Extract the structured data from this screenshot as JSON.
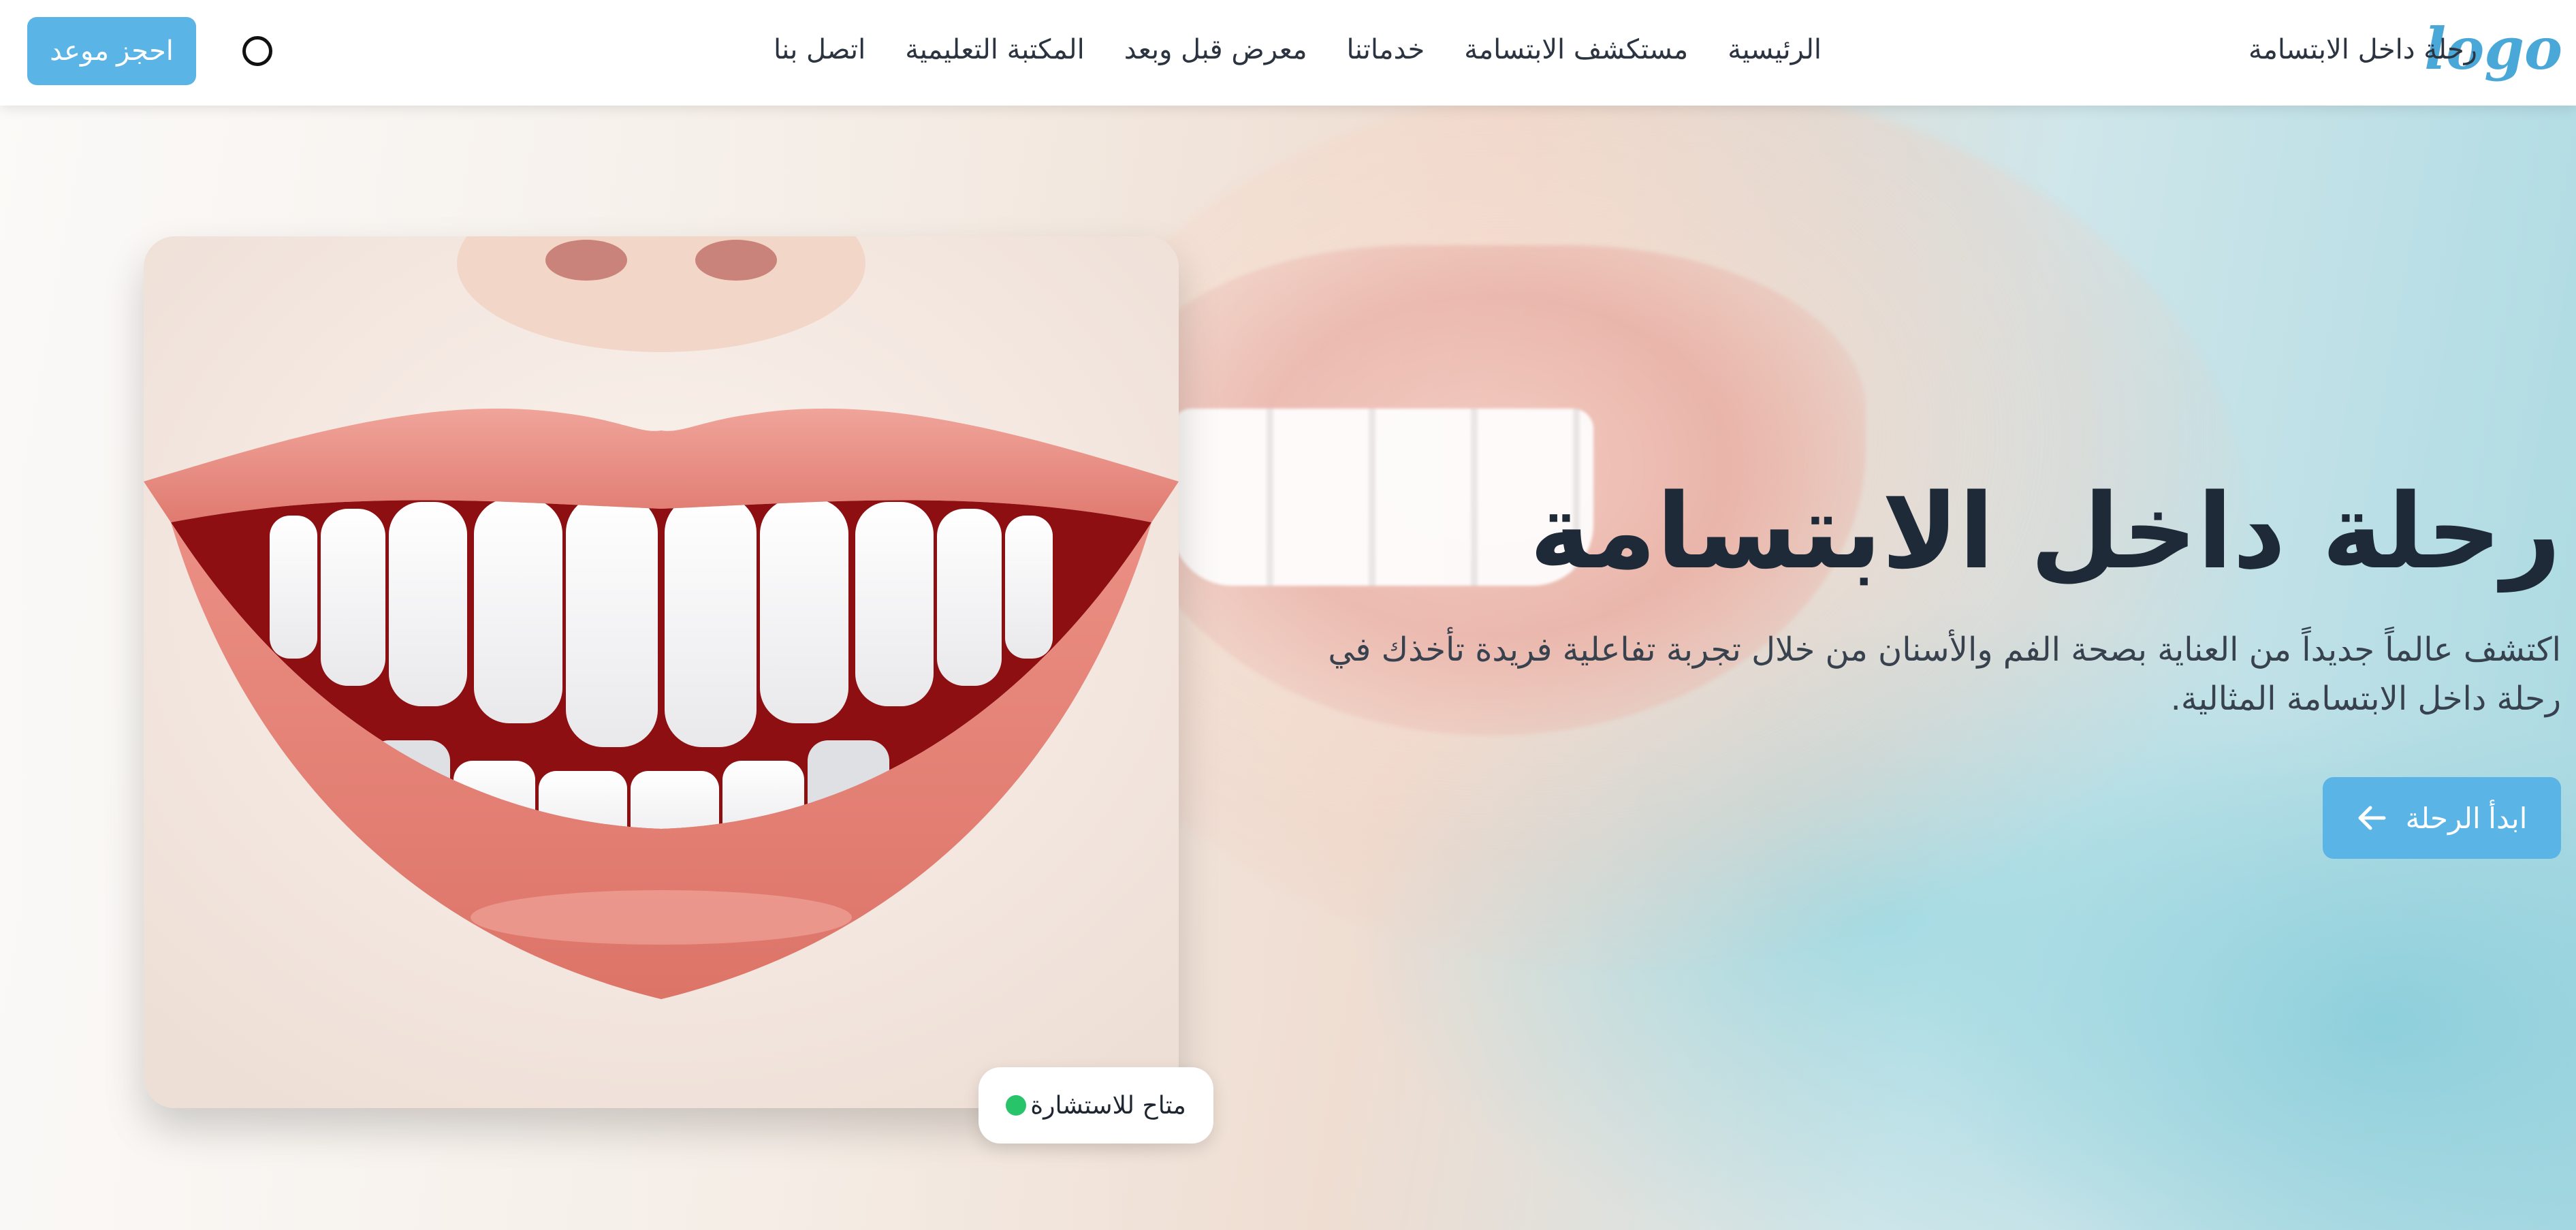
{
  "header": {
    "logo": "logo",
    "brand_name": "رحلة داخل الابتسامة",
    "nav": [
      {
        "label": "الرئيسية"
      },
      {
        "label": "مستكشف الابتسامة"
      },
      {
        "label": "خدماتنا"
      },
      {
        "label": "معرض قبل وبعد"
      },
      {
        "label": "المكتبة التعليمية"
      },
      {
        "label": "اتصل بنا"
      }
    ],
    "book_button": "احجز موعد",
    "theme_toggle_icon": "circle-icon"
  },
  "hero": {
    "title": "رحلة داخل الابتسامة",
    "description": "اكتشف عالماً جديداً من العناية بصحة الفم والأسنان من خلال تجربة تفاعلية فريدة تأخذك في رحلة داخل الابتسامة المثالية.",
    "cta_label": "ابدأ الرحلة",
    "cta_icon": "arrow-left-icon",
    "status_badge": "متاح للاستشارة",
    "status_color": "#27c46a"
  },
  "colors": {
    "accent": "#5ab4e6",
    "logo": "#4aa8d8",
    "title": "#1e2a38"
  }
}
